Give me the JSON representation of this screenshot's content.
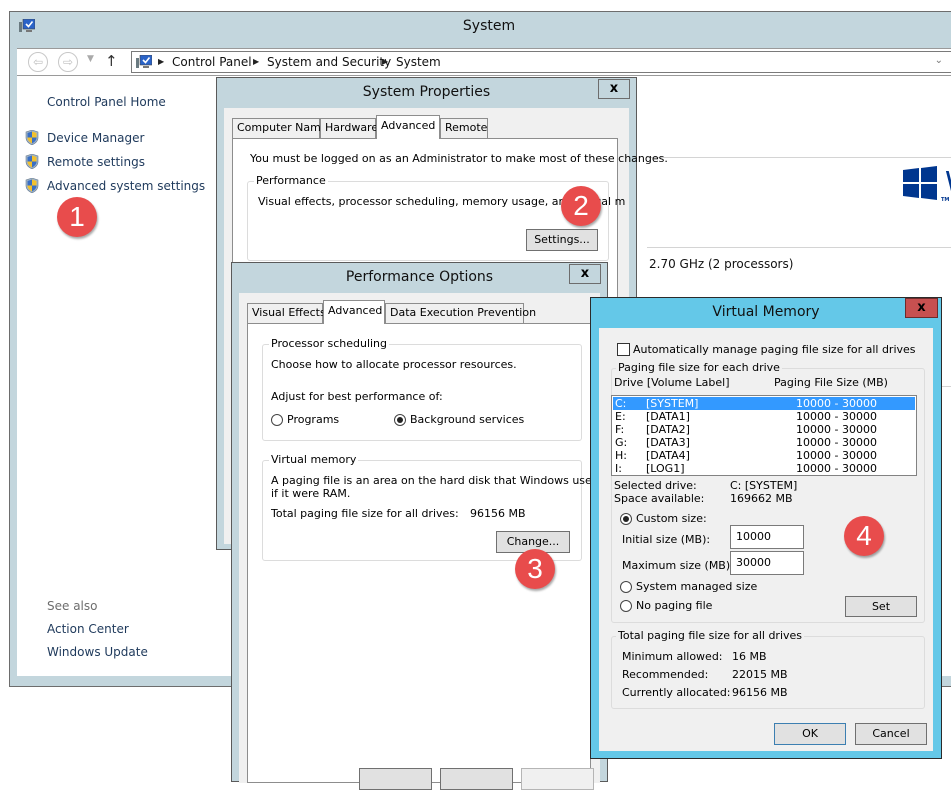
{
  "system_window": {
    "title": "System",
    "icons": {
      "app": "computer-icon",
      "back": "back-arrow-icon",
      "forward": "forward-arrow-icon",
      "recent": "chevron-down-icon",
      "up": "up-arrow-icon"
    },
    "breadcrumb": [
      "Control Panel",
      "System and Security",
      "System"
    ],
    "left_pane": {
      "home": "Control Panel Home",
      "links": [
        {
          "label": "Device Manager",
          "icon": "uac-shield-icon"
        },
        {
          "label": "Remote settings",
          "icon": "uac-shield-icon"
        },
        {
          "label": "Advanced system settings",
          "icon": "uac-shield-icon"
        }
      ],
      "see_also_label": "See also",
      "see_also": [
        "Action Center",
        "Windows Update"
      ]
    },
    "main": {
      "processor_info": "2.70 GHz  (2 processors)",
      "logo_text": "W",
      "logo_tm": "TM"
    }
  },
  "system_properties": {
    "title": "System Properties",
    "close": "x",
    "tabs": [
      {
        "label": "Computer Name",
        "active": false
      },
      {
        "label": "Hardware",
        "active": false
      },
      {
        "label": "Advanced",
        "active": true
      },
      {
        "label": "Remote",
        "active": false
      }
    ],
    "admin_notice": "You must be logged on as an Administrator to make most of these changes.",
    "performance": {
      "legend": "Performance",
      "description": "Visual effects, processor scheduling, memory usage, and virtual m",
      "button": "Settings..."
    },
    "bottom_buttons": [
      "",
      "",
      ""
    ]
  },
  "performance_options": {
    "title": "Performance Options",
    "close": "x",
    "tabs": [
      {
        "label": "Visual Effects",
        "active": false
      },
      {
        "label": "Advanced",
        "active": true
      },
      {
        "label": "Data Execution Prevention",
        "active": false
      }
    ],
    "processor_scheduling": {
      "legend": "Processor scheduling",
      "description": "Choose how to allocate processor resources.",
      "adjust_label": "Adjust for best performance of:",
      "options": [
        {
          "label": "Programs",
          "checked": false
        },
        {
          "label": "Background services",
          "checked": true
        }
      ]
    },
    "virtual_memory": {
      "legend": "Virtual memory",
      "description_line1": "A paging file is an area on the hard disk that Windows uses as",
      "description_line2": "if it were RAM.",
      "total_label": "Total paging file size for all drives:",
      "total_value": "96156 MB",
      "button": "Change..."
    }
  },
  "virtual_memory": {
    "title": "Virtual Memory",
    "close": "x",
    "auto_manage": {
      "label": "Automatically manage paging file size for all drives",
      "checked": false
    },
    "per_drive": {
      "legend": "Paging file size for each drive",
      "col_drive": "Drive  [Volume Label]",
      "col_size": "Paging File Size (MB)",
      "drives": [
        {
          "letter": "C:",
          "label": "[SYSTEM]",
          "size": "10000 - 30000",
          "selected": true
        },
        {
          "letter": "E:",
          "label": "[DATA1]",
          "size": "10000 - 30000",
          "selected": false
        },
        {
          "letter": "F:",
          "label": "[DATA2]",
          "size": "10000 - 30000",
          "selected": false
        },
        {
          "letter": "G:",
          "label": "[DATA3]",
          "size": "10000 - 30000",
          "selected": false
        },
        {
          "letter": "H:",
          "label": "[DATA4]",
          "size": "10000 - 30000",
          "selected": false
        },
        {
          "letter": "I:",
          "label": "[LOG1]",
          "size": "10000 - 30000",
          "selected": false
        }
      ],
      "selected_drive_label": "Selected drive:",
      "selected_drive_value": "C:  [SYSTEM]",
      "space_available_label": "Space available:",
      "space_available_value": "169662 MB",
      "custom_size": {
        "label": "Custom size:",
        "checked": true
      },
      "initial_size_label": "Initial size (MB):",
      "initial_size_value": "10000",
      "maximum_size_label": "Maximum size (MB):",
      "maximum_size_value": "30000",
      "system_managed": {
        "label": "System managed size",
        "checked": false
      },
      "no_paging": {
        "label": "No paging file",
        "checked": false
      },
      "set_button": "Set"
    },
    "totals": {
      "legend": "Total paging file size for all drives",
      "minimum_label": "Minimum allowed:",
      "minimum_value": "16 MB",
      "recommended_label": "Recommended:",
      "recommended_value": "22015 MB",
      "allocated_label": "Currently allocated:",
      "allocated_value": "96156 MB"
    },
    "ok_button": "OK",
    "cancel_button": "Cancel"
  },
  "badges": [
    "1",
    "2",
    "3",
    "4"
  ],
  "colors": {
    "title_bar": "#c3d6dd",
    "active_dialog_frame": "#64c8e8",
    "close_active": "#c75050",
    "selection": "#3399ff",
    "badge": "#e84c4c",
    "link": "#1e395b",
    "windows_logo": "#00368f"
  }
}
